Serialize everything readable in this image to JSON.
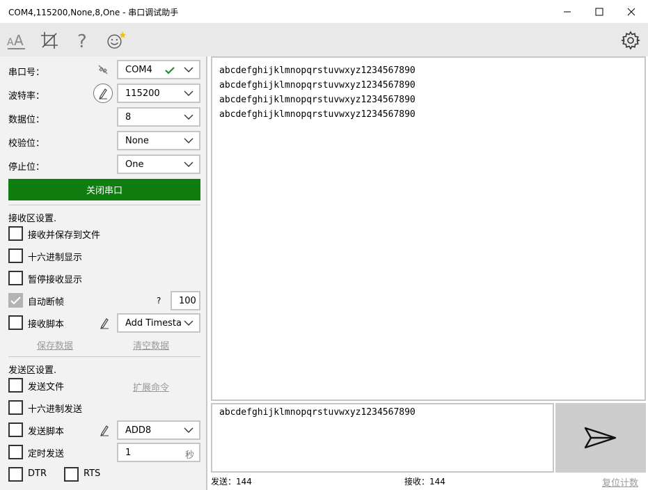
{
  "window": {
    "title": "COM4,115200,None,8,One - 串口调试助手"
  },
  "toolbar": {
    "icons": [
      "font-size-icon",
      "crop-icon",
      "help-icon",
      "smiley-icon",
      "settings-icon"
    ]
  },
  "serial": {
    "port_label": "串口号：",
    "port_value": "COM4",
    "baud_label": "波特率：",
    "baud_value": "115200",
    "data_bits_label": "数据位：",
    "data_bits_value": "8",
    "parity_label": "校验位：",
    "parity_value": "None",
    "stop_bits_label": "停止位：",
    "stop_bits_value": "One",
    "close_button": "关闭串口"
  },
  "receive_settings": {
    "section_title": "接收区设置.",
    "save_to_file": "接收并保存到文件",
    "hex_display": "十六进制显示",
    "pause_display": "暂停接收显示",
    "auto_frame": "自动断帧",
    "auto_frame_help": "?",
    "auto_frame_value": "100",
    "script_label": "接收脚本",
    "script_value": "Add Timesta",
    "save_data": "保存数据",
    "clear_data": "清空数据"
  },
  "send_settings": {
    "section_title": "发送区设置.",
    "send_file": "发送文件",
    "extend_cmd": "扩展命令",
    "hex_send": "十六进制发送",
    "script_label": "发送脚本",
    "script_value": "ADD8",
    "timed_send": "定时发送",
    "timed_value": "1",
    "timed_unit": "秒",
    "dtr": "DTR",
    "rts": "RTS"
  },
  "receive_area": {
    "text": "abcdefghijklmnopqrstuvwxyz1234567890\nabcdefghijklmnopqrstuvwxyz1234567890\nabcdefghijklmnopqrstuvwxyz1234567890\nabcdefghijklmnopqrstuvwxyz1234567890"
  },
  "send_area": {
    "text": "abcdefghijklmnopqrstuvwxyz1234567890"
  },
  "status": {
    "sent": "发送：144",
    "received": "接收：144",
    "reset": "复位计数"
  },
  "colors": {
    "accent_green": "#0f7d0f",
    "check_green": "#1f8f1f"
  }
}
